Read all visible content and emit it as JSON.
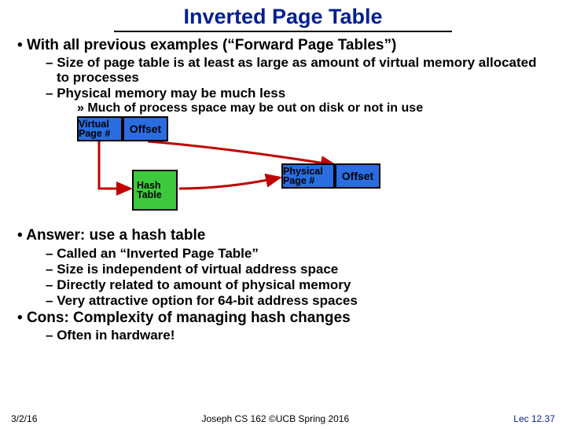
{
  "title": "Inverted Page Table",
  "bullets": {
    "b1": "With all previous examples (“Forward Page Tables”)",
    "b1a": "Size of page table is at least as large as amount of virtual memory allocated to processes",
    "b1b": "Physical memory may be much less",
    "b1b1": "Much of process space may be out on disk or not in use",
    "b2": "Answer: use a hash table",
    "b2a": "Called an “Inverted Page Table”",
    "b2b": "Size is independent of virtual address space",
    "b2c": "Directly related to amount of physical memory",
    "b2d": "Very attractive option for 64-bit address spaces",
    "b3": "Cons: Complexity of managing hash changes",
    "b3a": "Often in hardware!"
  },
  "diagram": {
    "virtual_page": "Virtual\nPage #",
    "offset1": "Offset",
    "hash": "Hash\nTable",
    "physical_page": "Physical\nPage #",
    "offset2": "Offset"
  },
  "footer": {
    "left": "3/2/16",
    "center": "Joseph CS 162 ©UCB Spring 2016",
    "right": "Lec 12.37"
  },
  "colors": {
    "title": "#001f8f",
    "box_blue": "#2a6de0",
    "box_green": "#3ec83e",
    "arrow": "#c00000"
  }
}
